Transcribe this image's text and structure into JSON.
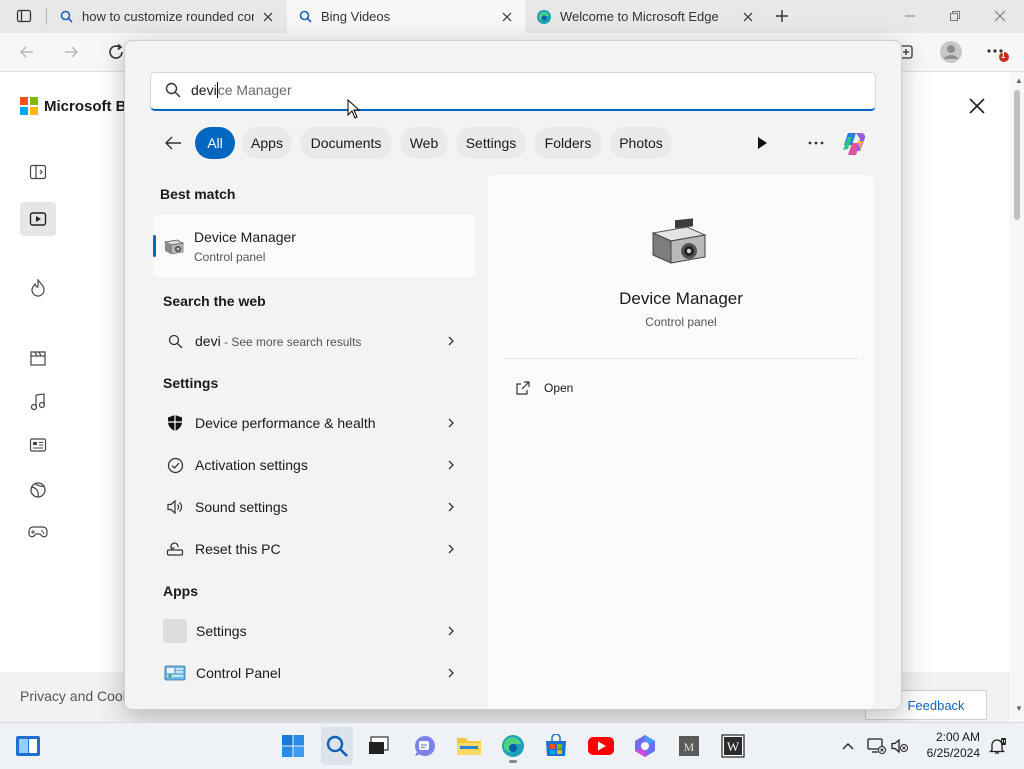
{
  "browser": {
    "tabs": [
      {
        "title": "how to customize rounded corn",
        "icon": "search-icon"
      },
      {
        "title": "Bing Videos",
        "icon": "search-icon"
      },
      {
        "title": "Welcome to Microsoft Edge",
        "icon": "edge-icon"
      }
    ],
    "new_tab_icon": "plus-icon",
    "window_controls": [
      "minimize-icon",
      "restore-icon",
      "close-icon"
    ],
    "notification_badge": "1"
  },
  "page": {
    "logo_text": "Microsoft Bin",
    "footer_text": "Privacy and Cook",
    "feedback_label": "Feedback",
    "rail_icons": [
      "collapse-panel-icon",
      "video-icon",
      "trending-icon",
      "clapperboard-icon",
      "music-icon",
      "news-icon",
      "sports-icon",
      "gaming-icon"
    ]
  },
  "search": {
    "typed": "devi",
    "suggestion": "ce Manager",
    "filters": [
      "All",
      "Apps",
      "Documents",
      "Web",
      "Settings",
      "Folders",
      "Photos"
    ],
    "active_filter": "All",
    "best_match_heading": "Best match",
    "best_match": {
      "title": "Device Manager",
      "subtitle": "Control panel"
    },
    "web_heading": "Search the web",
    "web_result": {
      "query": "devi",
      "suffix": " - See more search results"
    },
    "settings_heading": "Settings",
    "settings_items": [
      "Device performance & health",
      "Activation settings",
      "Sound settings",
      "Reset this PC"
    ],
    "apps_heading": "Apps",
    "apps_items": [
      "Settings",
      "Control Panel"
    ],
    "details": {
      "title": "Device Manager",
      "subtitle": "Control panel",
      "action": "Open"
    }
  },
  "taskbar": {
    "time": "2:00 AM",
    "date": "6/25/2024"
  },
  "colors": {
    "accent": "#0067c0",
    "taskbar": "#eef1f5",
    "panel": "#f3f3f3"
  }
}
